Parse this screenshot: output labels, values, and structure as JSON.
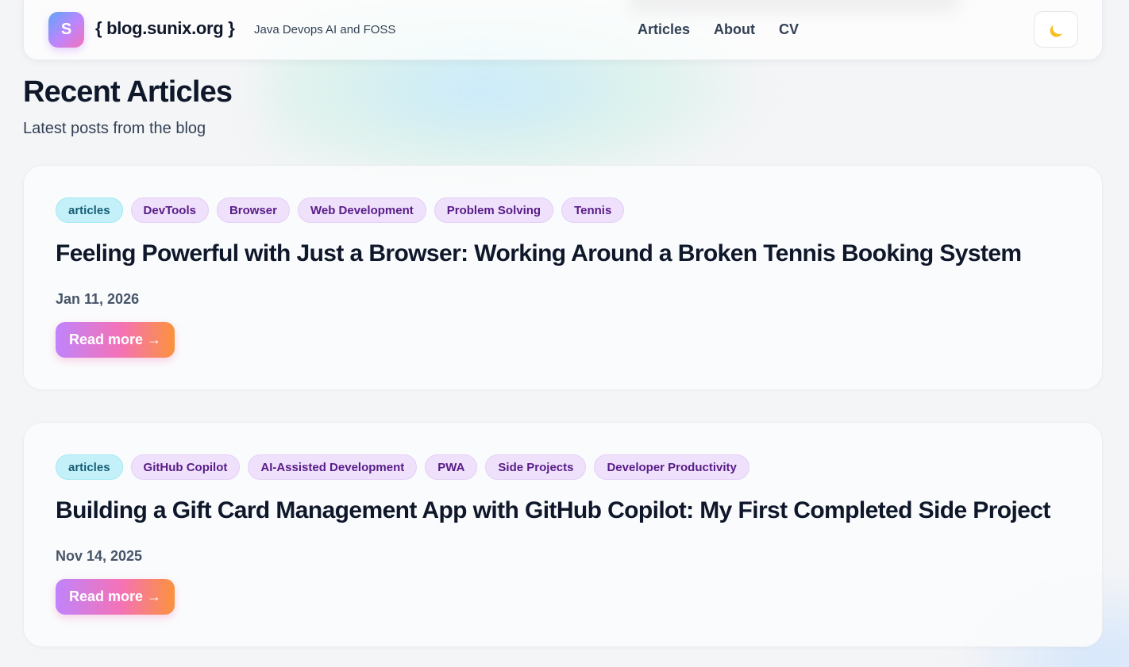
{
  "header": {
    "logo_letter": "S",
    "site_name": "{ blog.sunix.org }",
    "tagline": "Java Devops AI and FOSS",
    "nav": [
      {
        "label": "Articles"
      },
      {
        "label": "About"
      },
      {
        "label": "CV"
      }
    ],
    "theme_toggle_icon": "moon-icon"
  },
  "main": {
    "title": "Recent Articles",
    "subtitle": "Latest posts from the blog"
  },
  "articles": [
    {
      "primary_tag": "articles",
      "tags": [
        "DevTools",
        "Browser",
        "Web Development",
        "Problem Solving",
        "Tennis"
      ],
      "title": "Feeling Powerful with Just a Browser: Working Around a Broken Tennis Booking System",
      "date": "Jan 11, 2026",
      "read_more": "Read more →"
    },
    {
      "primary_tag": "articles",
      "tags": [
        "GitHub Copilot",
        "AI-Assisted Development",
        "PWA",
        "Side Projects",
        "Developer Productivity"
      ],
      "title": "Building a Gift Card Management App with GitHub Copilot: My First Completed Side Project",
      "date": "Nov 14, 2025",
      "read_more": "Read more →"
    }
  ],
  "colors": {
    "accent_gradient_start": "#c084fc",
    "accent_gradient_mid": "#f472b6",
    "accent_gradient_end": "#fb923c",
    "primary_tag_bg": "#c4f1f9",
    "secondary_tag_bg": "#efe1fb"
  }
}
